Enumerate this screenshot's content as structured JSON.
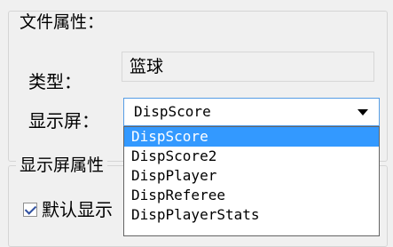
{
  "file_properties": {
    "legend": "文件属性：",
    "type_label": "类型：",
    "type_value": "篮球",
    "display_label": "显示屏：",
    "display_selected": "DispScore",
    "display_options": [
      "DispScore",
      "DispScore2",
      "DispPlayer",
      "DispReferee",
      "DispPlayerStats"
    ]
  },
  "display_properties": {
    "legend": "显示屏属性",
    "default_display_label": "默认显示",
    "default_display_checked": true
  },
  "colors": {
    "selection": "#3399ff",
    "combo_border": "#569de5",
    "background": "#f0f0f0"
  }
}
